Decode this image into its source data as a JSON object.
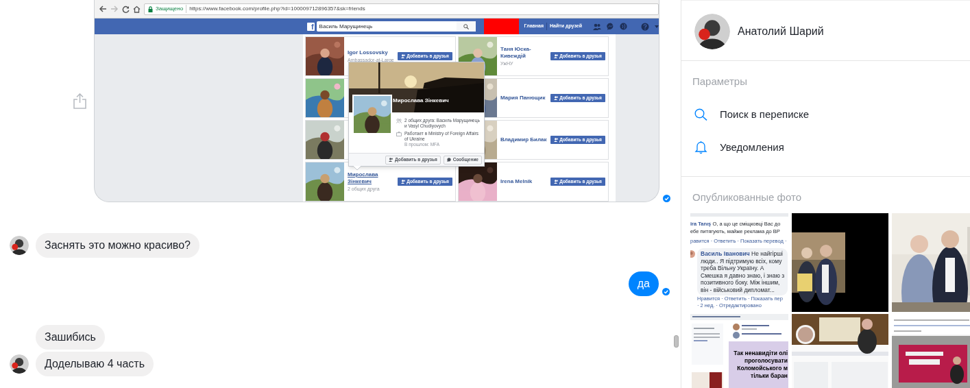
{
  "shared_screenshot": {
    "seen": true,
    "browser": {
      "secure_label": "Защищено",
      "url": "https://www.facebook.com/profile.php?id=100009712896357&sk=friends"
    },
    "facebook": {
      "logo": "f",
      "search_value": "Василь Марущинець",
      "nav": [
        "Главная",
        "Найти друзей"
      ],
      "friends": [
        {
          "kind": "full",
          "name": "Igor Lossovsky",
          "subtitle": "Ambassador-at-Large",
          "button": "Добавить в друзья",
          "hovered": false
        },
        {
          "kind": "full",
          "name": "Таня Юска-Кивеждій",
          "subtitle": "УжНУ",
          "button": "Добавить в друзья",
          "hovered": false
        },
        {
          "kind": "covered"
        },
        {
          "kind": "full",
          "name": "Мария Панющик",
          "button": "Добавить в друзья",
          "hovered": false
        },
        {
          "kind": "covered"
        },
        {
          "kind": "full",
          "name": "Владимир Билак",
          "button": "Добавить в друзья",
          "hovered": false
        },
        {
          "kind": "full",
          "name": "Мирослава Зінкевич",
          "subtitle": "2 общих друга",
          "button": "Добавить в друзья",
          "hovered": true
        },
        {
          "kind": "full",
          "name": "Irena Melnik",
          "button": "Добавить в друзья",
          "hovered": false
        }
      ],
      "hovercard": {
        "name": "Мирослава Зінкевич",
        "mutual": "2 общих друга: Василь Марущинець и Vasyl Chudiyovych",
        "work": "Работает в Ministry of Foreign Affairs of Ukraine",
        "past": "В прошлом: MFA",
        "buttons": [
          "Добавить в друзья",
          "Сообщение"
        ]
      }
    }
  },
  "messages": [
    {
      "kind": "incoming",
      "text": "Заснять это можно красиво?",
      "avatar": true
    },
    {
      "kind": "outgoing",
      "text": "да",
      "seen": true
    },
    {
      "kind": "incoming",
      "text": "Зашибись",
      "avatar": false
    },
    {
      "kind": "incoming",
      "text": "Доделываю 4 часть",
      "avatar": true
    }
  ],
  "sidebar": {
    "contact_name": "Анатолий Шарий",
    "settings_title": "Параметры",
    "options": [
      {
        "kind": "search",
        "label": "Поиск в переписке"
      },
      {
        "kind": "bell",
        "label": "Уведомления"
      }
    ],
    "photos_title": "Опубликованные фото",
    "photos": [
      {
        "kind": "comments",
        "top_lines": [
          "**ira Tanış** О, а що це сміщковці Вас до",
          "ебе питягують, майже реклама до ВР"
        ],
        "top_actions": "равится · Ответить · Показать перевод ·",
        "reply_lines": [
          "**Василь Іванович** Не найгірші",
          "люди.. Я підтримую всіх, кому",
          "треба Вільну Україну. А",
          "Смешка я давно знаю, і знаю з",
          "позитивного боку. Між іншим,",
          "він - військовий дипломат..."
        ],
        "reply_actions": [
          "Нравится · Ответить · Показать пер",
          "· 2 нед. · Отредактировано"
        ]
      },
      {
        "kind": "picture"
      },
      {
        "kind": "picture"
      },
      {
        "kind": "post",
        "lines": [
          "Так ненавидіти олі",
          "проголосувати",
          "Коломойського м",
          "тільки баран"
        ]
      },
      {
        "kind": "picture"
      },
      {
        "kind": "picture"
      }
    ]
  }
}
